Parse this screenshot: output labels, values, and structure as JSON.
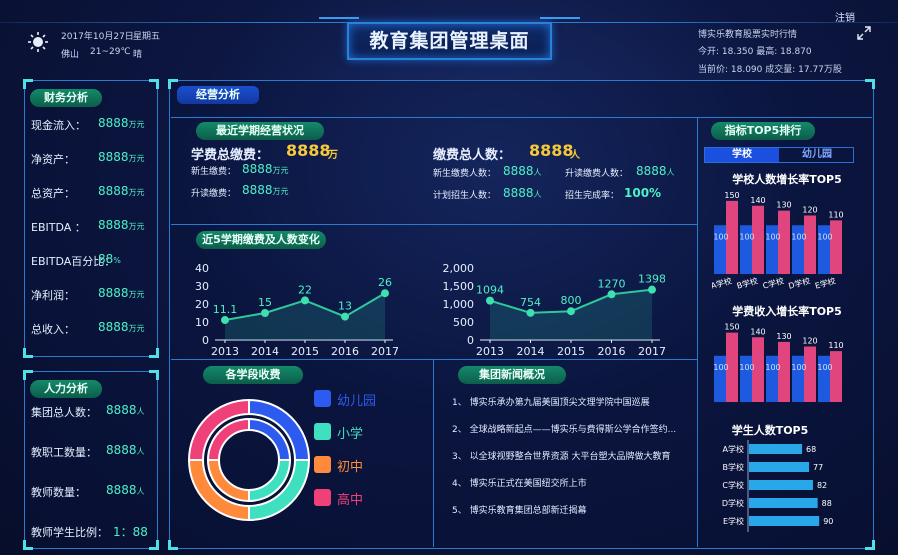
{
  "header": {
    "title": "教育集团管理桌面",
    "date": "2017年10月27日",
    "weekday": "星期五",
    "city": "佛山",
    "temp": "21~29℃",
    "weather": "晴",
    "logout": "注销",
    "stock_title": "博实乐教育股票实时行情",
    "stock_line1": "今开: 18.350   最高: 18.870",
    "stock_line2": "当前价: 18.090   成交量: 17.77万股"
  },
  "finance": {
    "title": "财务分析",
    "items": [
      {
        "label": "现金流入：",
        "value": "8888",
        "unit": "万元"
      },
      {
        "label": "净资产：",
        "value": "8888",
        "unit": "万元"
      },
      {
        "label": "总资产：",
        "value": "8888",
        "unit": "万元"
      },
      {
        "label": "EBITDA ：",
        "value": "8888",
        "unit": "万元"
      },
      {
        "label": "EBITDA百分比：",
        "value": "88",
        "unit": "%"
      },
      {
        "label": "净利润：",
        "value": "8888",
        "unit": "万元"
      },
      {
        "label": "总收入：",
        "value": "8888",
        "unit": "万元"
      }
    ]
  },
  "hr": {
    "title": "人力分析",
    "items": [
      {
        "label": "集团总人数：",
        "value": "8888",
        "unit": "人"
      },
      {
        "label": "教职工数量：",
        "value": "8888",
        "unit": "人"
      },
      {
        "label": "教师数量：",
        "value": "8888",
        "unit": "人"
      },
      {
        "label": "教师学生比例：",
        "value": "1：88",
        "unit": ""
      }
    ]
  },
  "operations": {
    "tab": "经营分析",
    "semester_title": "最近学期经营状况",
    "total_fee_label": "学费总缴费：",
    "total_fee_value": "8888",
    "total_fee_unit": "万",
    "new_fee_label": "新生缴费：",
    "new_fee_value": "8888",
    "new_fee_unit": "万元",
    "cont_fee_label": "升读缴费：",
    "cont_fee_value": "8888",
    "cont_fee_unit": "万元",
    "total_people_label": "缴费总人数：",
    "total_people_value": "8888",
    "total_people_unit": "人",
    "new_people_label": "新生缴费人数：",
    "new_people_value": "8888",
    "new_people_unit": "人",
    "cont_people_label": "升读缴费人数：",
    "cont_people_value": "8888",
    "cont_people_unit": "人",
    "plan_label": "计划招生人数：",
    "plan_value": "8888",
    "plan_unit": "人",
    "rate_label": "招生完成率：",
    "rate_value": "100%",
    "trend_title": "近5学期缴费及人数变化",
    "stage_title": "各学段收费",
    "news_title": "集团新闻概况",
    "news": [
      "1、 博实乐承办第九届美国顶尖文理学院中国巡展",
      "2、 全球战略新起点——博实乐与费得斯公学合作签约...",
      "3、 以全球视野整合世界资源 大平台塑大品牌做大教育",
      "4、 博实乐正式在美国纽交所上市",
      "5、 博实乐教育集团总部新迁揭幕"
    ]
  },
  "top5": {
    "title": "指标TOP5排行",
    "tab_school": "学校",
    "tab_kinder": "幼儿园"
  },
  "chart_data": [
    {
      "type": "line",
      "x": [
        "2013",
        "2014",
        "2015",
        "2016",
        "2017"
      ],
      "series": [
        {
          "values": [
            11.1,
            15,
            22,
            13,
            26
          ]
        }
      ],
      "ylim": [
        0,
        40
      ],
      "yticks": [
        0,
        10,
        20,
        30,
        40
      ],
      "title": ""
    },
    {
      "type": "line",
      "x": [
        "2013",
        "2014",
        "2015",
        "2016",
        "2017"
      ],
      "series": [
        {
          "values": [
            1094,
            754,
            800,
            1270,
            1398
          ]
        }
      ],
      "ylim": [
        0,
        2000
      ],
      "yticks": [
        "0",
        "500",
        "1,000",
        "1,500",
        "2,000"
      ],
      "title": ""
    },
    {
      "type": "pie",
      "title": "",
      "categories": [
        "幼儿园",
        "小学",
        "初中",
        "高中"
      ],
      "colors": [
        "#2d5bf0",
        "#3ee0c0",
        "#ff8a3c",
        "#f0407a"
      ],
      "outer": [
        25,
        25,
        25,
        25
      ],
      "inner": [
        25,
        25,
        25,
        25
      ]
    },
    {
      "type": "bar",
      "title": "学校人数增长率TOP5",
      "categories": [
        "A学校",
        "B学校",
        "C学校",
        "D学校",
        "E学校"
      ],
      "series": [
        {
          "values": [
            100,
            100,
            100,
            100,
            100
          ],
          "color": "#1e5ae0"
        },
        {
          "values": [
            150,
            140,
            130,
            120,
            110
          ],
          "color": "#e0457e"
        }
      ]
    },
    {
      "type": "bar",
      "title": "学费收入增长率TOP5",
      "categories": [
        "A学校",
        "B学校",
        "C学校",
        "D学校",
        "E学校"
      ],
      "series": [
        {
          "values": [
            100,
            100,
            100,
            100,
            100
          ],
          "color": "#1e5ae0"
        },
        {
          "values": [
            150,
            140,
            130,
            120,
            110
          ],
          "color": "#e0457e"
        }
      ]
    },
    {
      "type": "bar",
      "title": "学生人数TOP5",
      "orientation": "horizontal",
      "categories": [
        "A学校",
        "B学校",
        "C学校",
        "D学校",
        "E学校"
      ],
      "values": [
        68,
        77,
        82,
        88,
        90
      ],
      "xlim": [
        0,
        100
      ]
    }
  ]
}
